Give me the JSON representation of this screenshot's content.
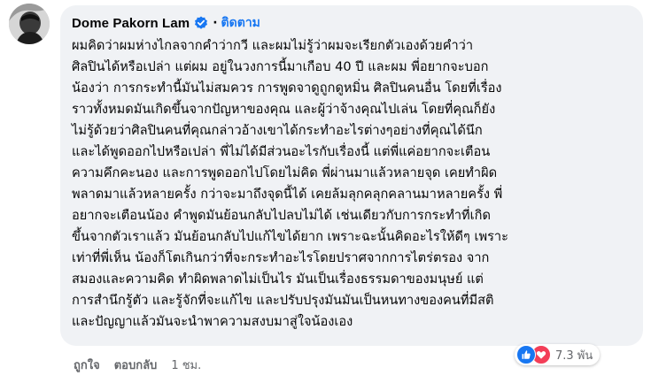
{
  "comment": {
    "author": "Dome Pakorn Lam",
    "follow_label": "ติดตาม",
    "dot": "·",
    "lines": [
      "ผมคิดว่าผมห่างไกลจากคำว่ากวี และผมไม่รู้ว่าผมจะเรียกตัวเองด้วยคำว่า",
      "ศิลปินได้หรือเปล่า แต่ผม อยู่ในวงการนี้มาเกือบ 40 ปี และผม พี่อยากจะบอก",
      "น้องว่า การกระทำนี้มันไม่สมควร การพูดจาดูถูกดูหมิ่น ศิลปินคนอื่น โดยที่เรื่อง",
      "ราวทั้งหมดมันเกิดขึ้นจากปัญหาของคุณ และผู้ว่าจ้างคุณไปเล่น โดยที่คุณก็ยัง",
      "ไม่รู้ด้วยว่าศิลปินคนที่คุณกล่าวอ้างเขาได้กระทำอะไรต่างๆอย่างที่คุณได้นึก",
      "และได้พูดออกไปหรือเปล่า พี่ไม่ได้มีส่วนอะไรกับเรื่องนี้ แต่พี่แค่อยากจะเตือน",
      "ความคึกคะนอง และการพูดออกไปโดยไม่คิด พี่ผ่านมาแล้วหลายจุด เคยทำผิด",
      "พลาดมาแล้วหลายครั้ง กว่าจะมาถึงจุดนี้ได้ เคยล้มลุกคลุกคลานมาหลายครั้ง พี่",
      "อยากจะเตือนน้อง คำพูดมันย้อนกลับไปลบไม่ได้ เช่นเดียวกับการกระทำที่เกิด",
      "ขึ้นจากตัวเราแล้ว มันย้อนกลับไปแก้ไขได้ยาก เพราะฉะนั้นคิดอะไรให้ดีๆ เพราะ",
      "เท่าที่พี่เห็น น้องก็โตเกินกว่าที่จะกระทำอะไรโดยปราศจากการไตร่ตรอง จาก",
      "สมองและความคิด ทำผิดพลาดไม่เป็นไร มันเป็นเรื่องธรรมดาของมนุษย์ แต่",
      "การสำนึกรู้ตัว และรู้จักที่จะแก้ไข และปรับปรุงมันมันเป็นหนทางของคนที่มีสติ",
      "และปัญญาแล้วมันจะนำพาความสงบมาสู่ใจน้องเอง"
    ]
  },
  "actions": {
    "like_label": "ถูกใจ",
    "reply_label": "ตอบกลับ",
    "time": "1 ชม."
  },
  "reactions": {
    "count": "7.3 พัน",
    "icons": [
      "like-icon",
      "love-icon"
    ]
  },
  "colors": {
    "accent": "#1877f2",
    "bubble": "#f0f2f5",
    "love": "#f33e58",
    "muted": "#65676b"
  }
}
